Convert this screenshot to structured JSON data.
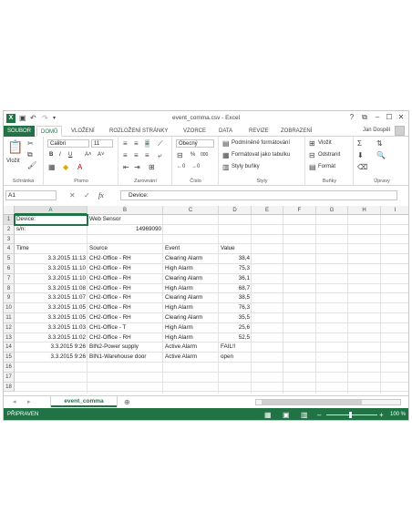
{
  "window": {
    "title": "event_comma.csv - Excel",
    "controls": [
      "?",
      "⧉",
      "–",
      "☐",
      "✕"
    ]
  },
  "tabs": [
    "SOUBOR",
    "DOMŮ",
    "VLOŽENÍ",
    "ROZLOŽENÍ STRÁNKY",
    "VZORCE",
    "DATA",
    "REVIZE",
    "ZOBRAZENÍ"
  ],
  "user": "Jan Dospěl",
  "ribbon": {
    "clipboard": {
      "paste": "Vložit",
      "label": "Schránka"
    },
    "font": {
      "name": "Calibri",
      "size": "11",
      "bold": "B",
      "italic": "I",
      "underline": "U",
      "grow": "A˄",
      "shrink": "A˅",
      "label": "Písmo"
    },
    "alignment": {
      "label": "Zarovnání"
    },
    "number": {
      "format": "Obecný",
      "percent": "%",
      "thousands": "000",
      "label": "Číslo"
    },
    "styles": {
      "conditional": "Podmíněné formátování",
      "table": "Formátovat jako tabulku",
      "cell": "Styly buňky",
      "label": "Styly"
    },
    "cells": {
      "insert": "Vložit",
      "delete": "Odstranit",
      "format": "Formát",
      "label": "Buňky"
    },
    "editing": {
      "label": "Úpravy"
    }
  },
  "formula_bar": {
    "name_box": "A1",
    "fx": "fx",
    "content": "Device:"
  },
  "columns": [
    "A",
    "B",
    "C",
    "D",
    "E",
    "F",
    "G",
    "H",
    "I"
  ],
  "rows": [
    {
      "n": "1",
      "a": "Device:",
      "b": "Web Sensor",
      "c": "",
      "d": ""
    },
    {
      "n": "2",
      "a": "s/n:",
      "b": "14969090",
      "c": "",
      "d": ""
    },
    {
      "n": "3",
      "a": "",
      "b": "",
      "c": "",
      "d": ""
    },
    {
      "n": "4",
      "a": "Time",
      "b": "Source",
      "c": "Event",
      "d": "Value"
    },
    {
      "n": "5",
      "a": "3.3.2015 11:13",
      "b": "CH2-Office - RH",
      "c": "Clearing Alarm",
      "d": "38,4"
    },
    {
      "n": "6",
      "a": "3.3.2015 11:10",
      "b": "CH2-Office - RH",
      "c": "High Alarm",
      "d": "75,3"
    },
    {
      "n": "7",
      "a": "3.3.2015 11:10",
      "b": "CH2-Office - RH",
      "c": "Clearing Alarm",
      "d": "36,1"
    },
    {
      "n": "8",
      "a": "3.3.2015 11:08",
      "b": "CH2-Office - RH",
      "c": "High Alarm",
      "d": "68,7"
    },
    {
      "n": "9",
      "a": "3.3.2015 11:07",
      "b": "CH2-Office - RH",
      "c": "Clearing Alarm",
      "d": "38,5"
    },
    {
      "n": "10",
      "a": "3.3.2015 11:05",
      "b": "CH2-Office - RH",
      "c": "High Alarm",
      "d": "76,3"
    },
    {
      "n": "11",
      "a": "3.3.2015 11:05",
      "b": "CH2-Office - RH",
      "c": "Clearing Alarm",
      "d": "35,5"
    },
    {
      "n": "12",
      "a": "3.3.2015 11:03",
      "b": "CH1-Office - T",
      "c": "High Alarm",
      "d": "25,6"
    },
    {
      "n": "13",
      "a": "3.3.2015 11:02",
      "b": "CH2-Office - RH",
      "c": "High Alarm",
      "d": "52,5"
    },
    {
      "n": "14",
      "a": "3.3.2015 9:26",
      "b": "BIN2-Power supply",
      "c": "Active Alarm",
      "d": "FAIL!!"
    },
    {
      "n": "15",
      "a": "3.3.2015 9:26",
      "b": "BIN1-Warehouse door",
      "c": "Active Alarm",
      "d": "open"
    },
    {
      "n": "16",
      "a": "",
      "b": "",
      "c": "",
      "d": ""
    },
    {
      "n": "17",
      "a": "",
      "b": "",
      "c": "",
      "d": ""
    },
    {
      "n": "18",
      "a": "",
      "b": "",
      "c": "",
      "d": ""
    }
  ],
  "sheet": {
    "tab": "event_comma",
    "add": "⊕"
  },
  "status": {
    "mode": "PŘIPRAVEN",
    "zoom": "100 %"
  },
  "colors": {
    "accent": "#217346"
  }
}
